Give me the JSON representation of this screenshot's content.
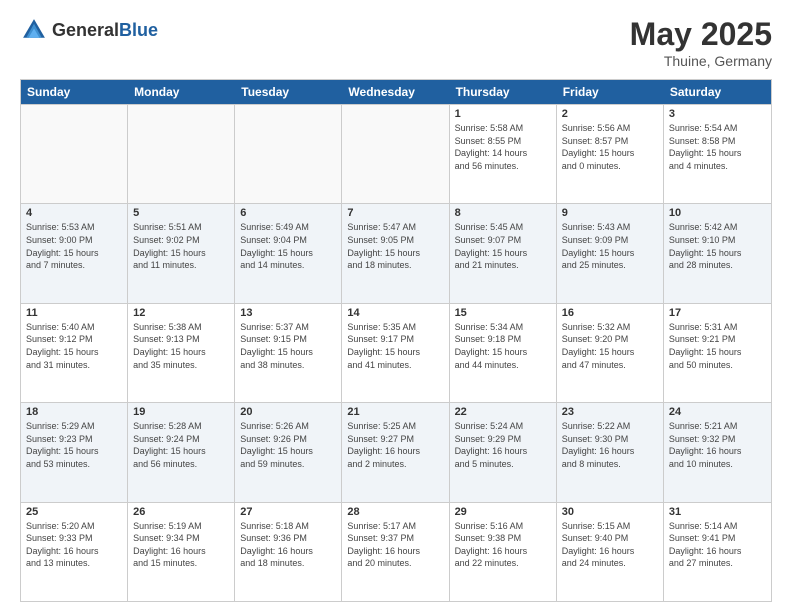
{
  "header": {
    "logo_general": "General",
    "logo_blue": "Blue",
    "title": "May 2025",
    "location": "Thuine, Germany"
  },
  "calendar": {
    "days_of_week": [
      "Sunday",
      "Monday",
      "Tuesday",
      "Wednesday",
      "Thursday",
      "Friday",
      "Saturday"
    ],
    "weeks": [
      [
        {
          "day": "",
          "info": ""
        },
        {
          "day": "",
          "info": ""
        },
        {
          "day": "",
          "info": ""
        },
        {
          "day": "",
          "info": ""
        },
        {
          "day": "1",
          "info": "Sunrise: 5:58 AM\nSunset: 8:55 PM\nDaylight: 14 hours\nand 56 minutes."
        },
        {
          "day": "2",
          "info": "Sunrise: 5:56 AM\nSunset: 8:57 PM\nDaylight: 15 hours\nand 0 minutes."
        },
        {
          "day": "3",
          "info": "Sunrise: 5:54 AM\nSunset: 8:58 PM\nDaylight: 15 hours\nand 4 minutes."
        }
      ],
      [
        {
          "day": "4",
          "info": "Sunrise: 5:53 AM\nSunset: 9:00 PM\nDaylight: 15 hours\nand 7 minutes."
        },
        {
          "day": "5",
          "info": "Sunrise: 5:51 AM\nSunset: 9:02 PM\nDaylight: 15 hours\nand 11 minutes."
        },
        {
          "day": "6",
          "info": "Sunrise: 5:49 AM\nSunset: 9:04 PM\nDaylight: 15 hours\nand 14 minutes."
        },
        {
          "day": "7",
          "info": "Sunrise: 5:47 AM\nSunset: 9:05 PM\nDaylight: 15 hours\nand 18 minutes."
        },
        {
          "day": "8",
          "info": "Sunrise: 5:45 AM\nSunset: 9:07 PM\nDaylight: 15 hours\nand 21 minutes."
        },
        {
          "day": "9",
          "info": "Sunrise: 5:43 AM\nSunset: 9:09 PM\nDaylight: 15 hours\nand 25 minutes."
        },
        {
          "day": "10",
          "info": "Sunrise: 5:42 AM\nSunset: 9:10 PM\nDaylight: 15 hours\nand 28 minutes."
        }
      ],
      [
        {
          "day": "11",
          "info": "Sunrise: 5:40 AM\nSunset: 9:12 PM\nDaylight: 15 hours\nand 31 minutes."
        },
        {
          "day": "12",
          "info": "Sunrise: 5:38 AM\nSunset: 9:13 PM\nDaylight: 15 hours\nand 35 minutes."
        },
        {
          "day": "13",
          "info": "Sunrise: 5:37 AM\nSunset: 9:15 PM\nDaylight: 15 hours\nand 38 minutes."
        },
        {
          "day": "14",
          "info": "Sunrise: 5:35 AM\nSunset: 9:17 PM\nDaylight: 15 hours\nand 41 minutes."
        },
        {
          "day": "15",
          "info": "Sunrise: 5:34 AM\nSunset: 9:18 PM\nDaylight: 15 hours\nand 44 minutes."
        },
        {
          "day": "16",
          "info": "Sunrise: 5:32 AM\nSunset: 9:20 PM\nDaylight: 15 hours\nand 47 minutes."
        },
        {
          "day": "17",
          "info": "Sunrise: 5:31 AM\nSunset: 9:21 PM\nDaylight: 15 hours\nand 50 minutes."
        }
      ],
      [
        {
          "day": "18",
          "info": "Sunrise: 5:29 AM\nSunset: 9:23 PM\nDaylight: 15 hours\nand 53 minutes."
        },
        {
          "day": "19",
          "info": "Sunrise: 5:28 AM\nSunset: 9:24 PM\nDaylight: 15 hours\nand 56 minutes."
        },
        {
          "day": "20",
          "info": "Sunrise: 5:26 AM\nSunset: 9:26 PM\nDaylight: 15 hours\nand 59 minutes."
        },
        {
          "day": "21",
          "info": "Sunrise: 5:25 AM\nSunset: 9:27 PM\nDaylight: 16 hours\nand 2 minutes."
        },
        {
          "day": "22",
          "info": "Sunrise: 5:24 AM\nSunset: 9:29 PM\nDaylight: 16 hours\nand 5 minutes."
        },
        {
          "day": "23",
          "info": "Sunrise: 5:22 AM\nSunset: 9:30 PM\nDaylight: 16 hours\nand 8 minutes."
        },
        {
          "day": "24",
          "info": "Sunrise: 5:21 AM\nSunset: 9:32 PM\nDaylight: 16 hours\nand 10 minutes."
        }
      ],
      [
        {
          "day": "25",
          "info": "Sunrise: 5:20 AM\nSunset: 9:33 PM\nDaylight: 16 hours\nand 13 minutes."
        },
        {
          "day": "26",
          "info": "Sunrise: 5:19 AM\nSunset: 9:34 PM\nDaylight: 16 hours\nand 15 minutes."
        },
        {
          "day": "27",
          "info": "Sunrise: 5:18 AM\nSunset: 9:36 PM\nDaylight: 16 hours\nand 18 minutes."
        },
        {
          "day": "28",
          "info": "Sunrise: 5:17 AM\nSunset: 9:37 PM\nDaylight: 16 hours\nand 20 minutes."
        },
        {
          "day": "29",
          "info": "Sunrise: 5:16 AM\nSunset: 9:38 PM\nDaylight: 16 hours\nand 22 minutes."
        },
        {
          "day": "30",
          "info": "Sunrise: 5:15 AM\nSunset: 9:40 PM\nDaylight: 16 hours\nand 24 minutes."
        },
        {
          "day": "31",
          "info": "Sunrise: 5:14 AM\nSunset: 9:41 PM\nDaylight: 16 hours\nand 27 minutes."
        }
      ]
    ]
  }
}
